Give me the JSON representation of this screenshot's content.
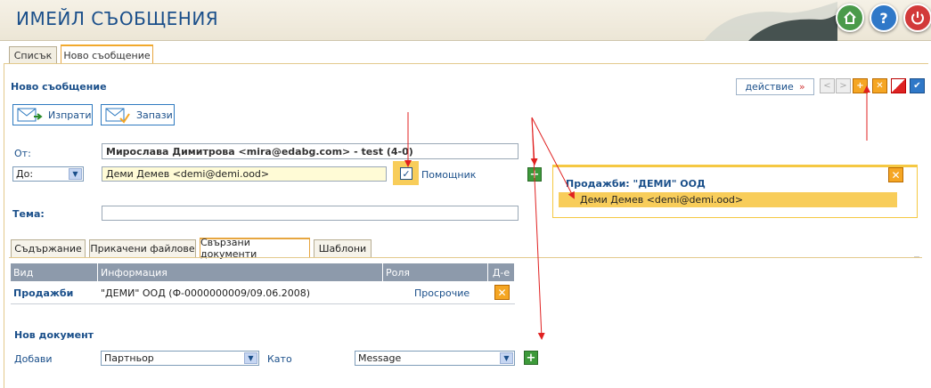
{
  "header": {
    "title": "ИМЕЙЛ СЪОБЩЕНИЯ"
  },
  "top_tabs": [
    {
      "label": "Списък"
    },
    {
      "label": "Ново съобщение"
    }
  ],
  "section_title": "Ново съобщение",
  "action_button": {
    "label": "действие",
    "chevron": "»"
  },
  "toolbar": {
    "send": "Изпрати",
    "save": "Запази"
  },
  "form": {
    "from_label": "От:",
    "from_value": "Мирослава Димитрова <mira@edabg.com> - test (4-0)",
    "to_select": "До:",
    "to_value": "Деми Демев <demi@demi.ood>",
    "assistant_label": "Помощник",
    "subject_label": "Тема:",
    "subject_value": ""
  },
  "content_tabs": [
    {
      "label": "Съдържание"
    },
    {
      "label": "Прикачени файлове"
    },
    {
      "label": "Свързани документи"
    },
    {
      "label": "Шаблони"
    }
  ],
  "table": {
    "headers": [
      "Вид",
      "Информация",
      "Роля",
      "Д-е"
    ],
    "rows": [
      {
        "type": "Продажби",
        "info": "\"ДЕМИ\" ООД (Ф-0000000009/09.06.2008)",
        "role": "Просрочие"
      }
    ]
  },
  "new_doc": {
    "title": "Нов документ",
    "add_label": "Добави",
    "add_select": "Партньор",
    "as_label": "Като",
    "as_select": "Message"
  },
  "popup": {
    "title": "Продажби: \"ДЕМИ\" ООД",
    "item": "Деми Демев <demi@demi.ood>"
  },
  "colors": {
    "accent": "#1a4f8a",
    "highlight": "#f5c842",
    "orange": "#f5a623",
    "arrow": "#e02020"
  }
}
